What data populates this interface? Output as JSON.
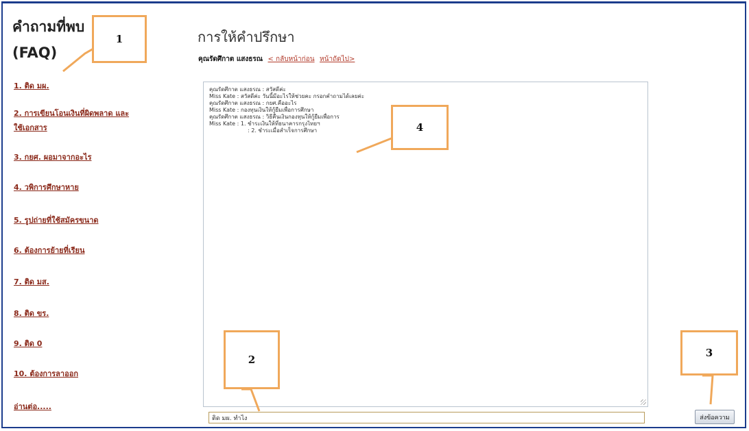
{
  "sidebar": {
    "title": "คำถามที่พบ (FAQ)",
    "items": [
      {
        "label": "1. ติด มผ."
      },
      {
        "label": "2. การเขียนโอนเงินที่ผิดพลาด และใช้เอกสาร"
      },
      {
        "label": "3. กยศ. ผอมาจากอะไร"
      },
      {
        "label": "4. วพิการศึกษาหาย"
      },
      {
        "label": "5. รูปถ่ายที่ใช้สมัครขนาด"
      },
      {
        "label": "6. ต้องการย้ายที่เรียน"
      },
      {
        "label": "7. ติด มส."
      },
      {
        "label": "8. ติด ขร."
      },
      {
        "label": "9. ติด 0"
      },
      {
        "label": "10. ต้องการลาออก"
      },
      {
        "label": "อ่านต่อ....."
      }
    ]
  },
  "main": {
    "title": "การให้คำปรึกษา",
    "user": "คุณรัดศึกาต แสงธรณ",
    "nav_prev": "< กลับหน้าก่อน",
    "nav_next": "หน้าถัดไป>"
  },
  "chat": {
    "lines": [
      {
        "text": "คุณรัดศึกาต แสงธรณ : สวัสดีค่ะ",
        "indent": false
      },
      {
        "text": "Miss Kate : สวัสดีค่ะ วันนี้มีอะไรให้ช่วยคะ กรอกคำถามได้เลยค่ะ",
        "indent": false
      },
      {
        "text": "คุณรัดศึกาต แสงธรณ : กยศ.คืออะไร",
        "indent": false
      },
      {
        "text": "Miss Kate : กองทุนเงินให้กู้ยืมเพื่อการศึกษา",
        "indent": false
      },
      {
        "text": "คุณรัดศึกาต แสงธรณ : วิธีคืนเงินกองทุนให้กู้ยืมเพื่อการ",
        "indent": false
      },
      {
        "text": "Miss Kate : 1. ชำระเงินให้ที่ธนาคารกรุงไทยฯ",
        "indent": false
      },
      {
        "text": ": 2. ชำระเมื่อสำเร็จการศึกษา",
        "indent": true
      }
    ],
    "input_value": "ติด มผ. ทำไง",
    "send_label": "ส่งข้อความ"
  },
  "annotations": {
    "c1": "1",
    "c2": "2",
    "c3": "3",
    "c4": "4",
    "color": "#f0a85a"
  },
  "colors": {
    "link": "#8b2a1b",
    "border": "#1b3c8c"
  }
}
